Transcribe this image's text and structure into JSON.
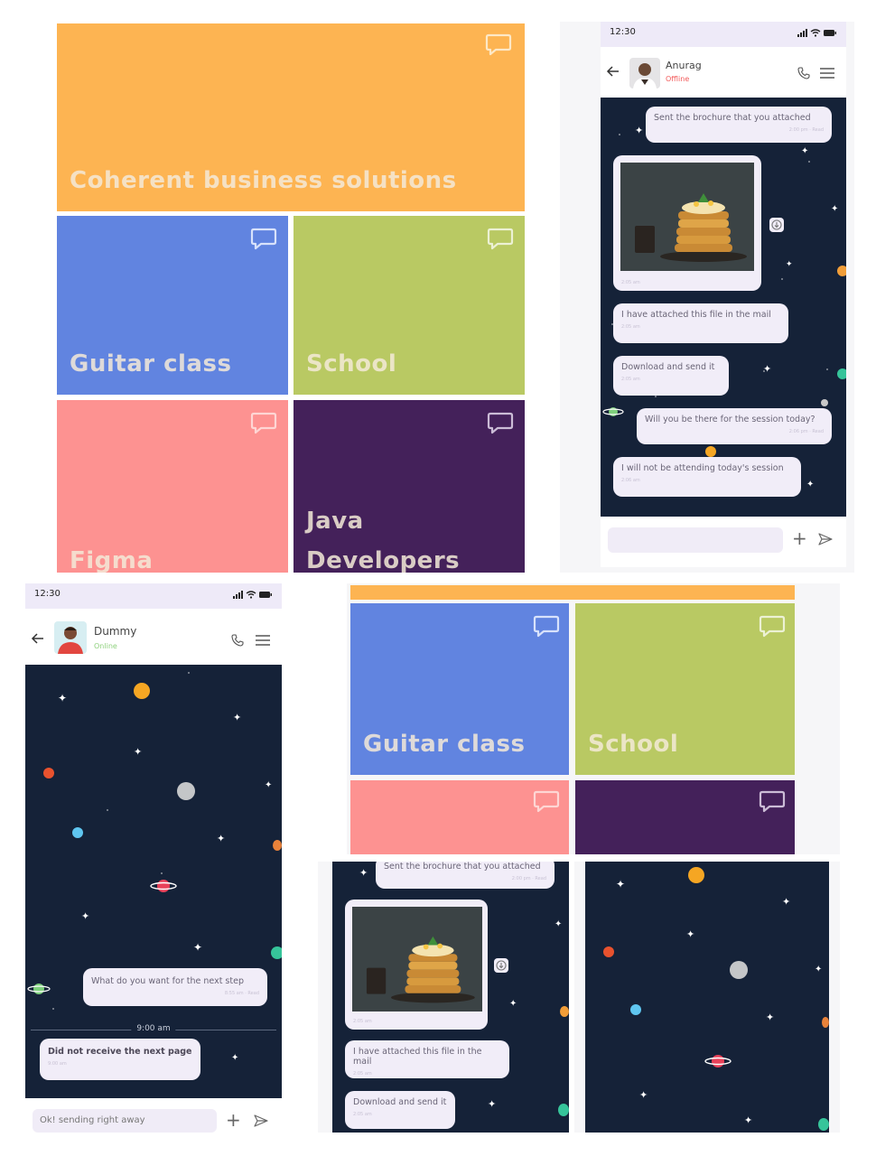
{
  "colors": {
    "orange": "#fdb452",
    "blue": "#6184e0",
    "green": "#b9c963",
    "pink": "#fd9291",
    "purple": "#44215a",
    "space": "#152238",
    "bubble": "#f1edf8"
  },
  "tiles": {
    "coherent": "Coherent business solutions",
    "guitar": "Guitar class",
    "school": "School",
    "figma": "Figma",
    "java_line1": "Java",
    "java_line2": "Developers",
    "icon": "chat-bubble-icon"
  },
  "phone1": {
    "time": "12:30",
    "contact_name": "Anurag",
    "contact_status": "Offline",
    "messages": [
      {
        "text": "Sent the brochure that you attached",
        "meta": "2:00 pm · Read"
      },
      {
        "text": "",
        "meta": "2:05 am"
      },
      {
        "text": "I have attached this file in the mail",
        "meta": "2:05 am"
      },
      {
        "text": "Download and send it",
        "meta": "2:05 am"
      },
      {
        "text": "Will you be there for the session today?",
        "meta": "2:06 pm · Read"
      },
      {
        "text": "I will not be attending today's session",
        "meta": "2:06 am"
      }
    ],
    "input_placeholder": ""
  },
  "phone2": {
    "time": "12:30",
    "contact_name": "Dummy",
    "contact_status": "Online",
    "messages": [
      {
        "text": "What do you want for the next step",
        "meta": "8:55 am · Read"
      },
      {
        "text": "Did not receive the next page",
        "meta": "9:00 am"
      }
    ],
    "divider": "9:00 am",
    "input_value": "Ok! sending right away"
  },
  "crop": {
    "messages": [
      {
        "text": "Sent the brochure that you attached",
        "meta": "2:00 pm · Read"
      },
      {
        "text": "",
        "meta": "2:05 am"
      },
      {
        "text": "I have attached this file in the mail",
        "meta": "2:05 am"
      },
      {
        "text": "Download and send it",
        "meta": "2:05 am"
      }
    ]
  }
}
